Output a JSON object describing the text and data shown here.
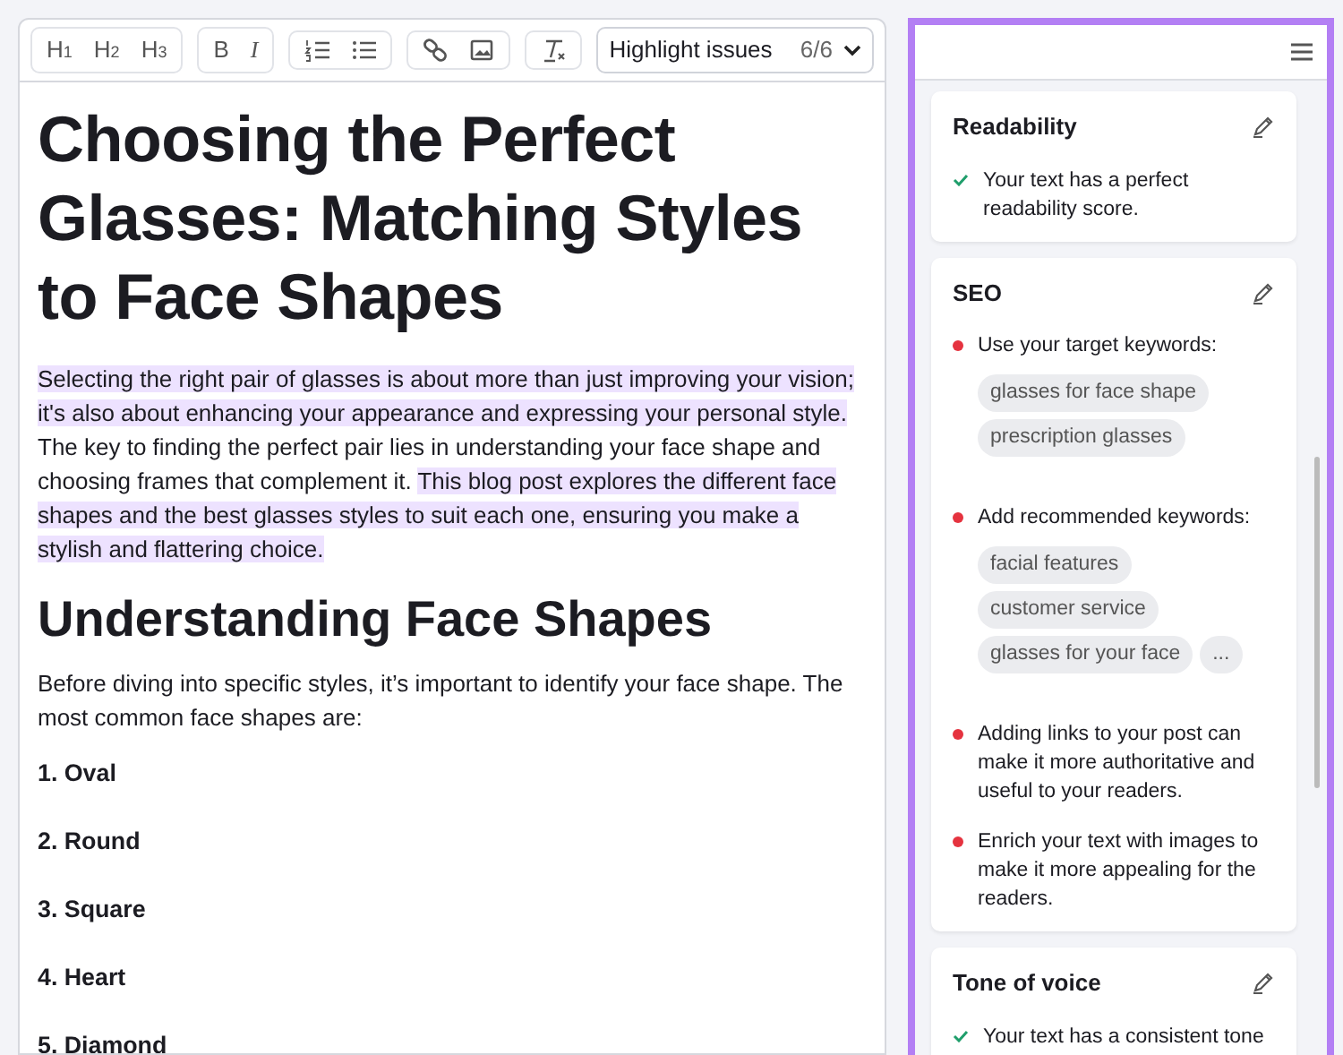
{
  "toolbar": {
    "groups": [
      [
        {
          "kind": "heading",
          "label": "H$_{1}$"
        },
        {
          "kind": "heading",
          "label": "H$_{2}$"
        },
        {
          "kind": "heading",
          "label": "H$_{3}$"
        }
      ],
      [
        {
          "kind": "bold",
          "label": "B"
        },
        {
          "kind": "italic",
          "label": "I"
        }
      ],
      [
        {
          "kind": "ordered-list"
        },
        {
          "kind": "bullet-list"
        }
      ],
      [
        {
          "kind": "link"
        },
        {
          "kind": "image"
        }
      ],
      [
        {
          "kind": "clear-format"
        }
      ]
    ],
    "dropdown": {
      "label": "Highlight issues",
      "count": "6/6"
    }
  },
  "document": {
    "title": "Choosing the Perfect Glasses: Matching Styles to Face Shapes",
    "intro": [
      {
        "text": "Selecting the right pair of glasses is about more than just improving your vision; it's also about enhancing your appearance and expressing your personal style.",
        "highlighted": true
      },
      {
        "text": " The key to finding the perfect pair lies in understanding your face shape and choosing frames that complement it. ",
        "highlighted": false
      },
      {
        "text": "This blog post explores the different face shapes and the best glasses styles to suit each one, ensuring you make a stylish and flattering choice.",
        "highlighted": true
      }
    ],
    "heading": "Understanding Face Shapes",
    "paragraph": "Before diving into specific styles, it’s important to identify your face shape. The most common face shapes are:",
    "list": [
      "1. Oval",
      "2. Round",
      "3. Square",
      "4. Heart",
      "5. Diamond"
    ]
  },
  "panel": {
    "sections": [
      {
        "title": "Readability",
        "items": [
          {
            "kind": "ok",
            "text": "Your text has a perfect readability score."
          }
        ]
      },
      {
        "title": "SEO",
        "items": [
          {
            "kind": "issue",
            "text": "Use your target keywords:",
            "tags": [
              "glasses for face shape",
              "prescription glasses"
            ]
          },
          {
            "kind": "issue",
            "text": "Add recommended keywords:",
            "tags": [
              "facial features",
              "customer service",
              "glasses for your face",
              "..."
            ]
          },
          {
            "kind": "issue",
            "text": "Adding links to your post can make it more authoritative and useful to your readers."
          },
          {
            "kind": "issue",
            "text": "Enrich your text with images to make it more appealing for the readers."
          }
        ]
      },
      {
        "title": "Tone of voice",
        "items": [
          {
            "kind": "ok",
            "text": "Your text has a consistent tone"
          }
        ]
      }
    ]
  }
}
